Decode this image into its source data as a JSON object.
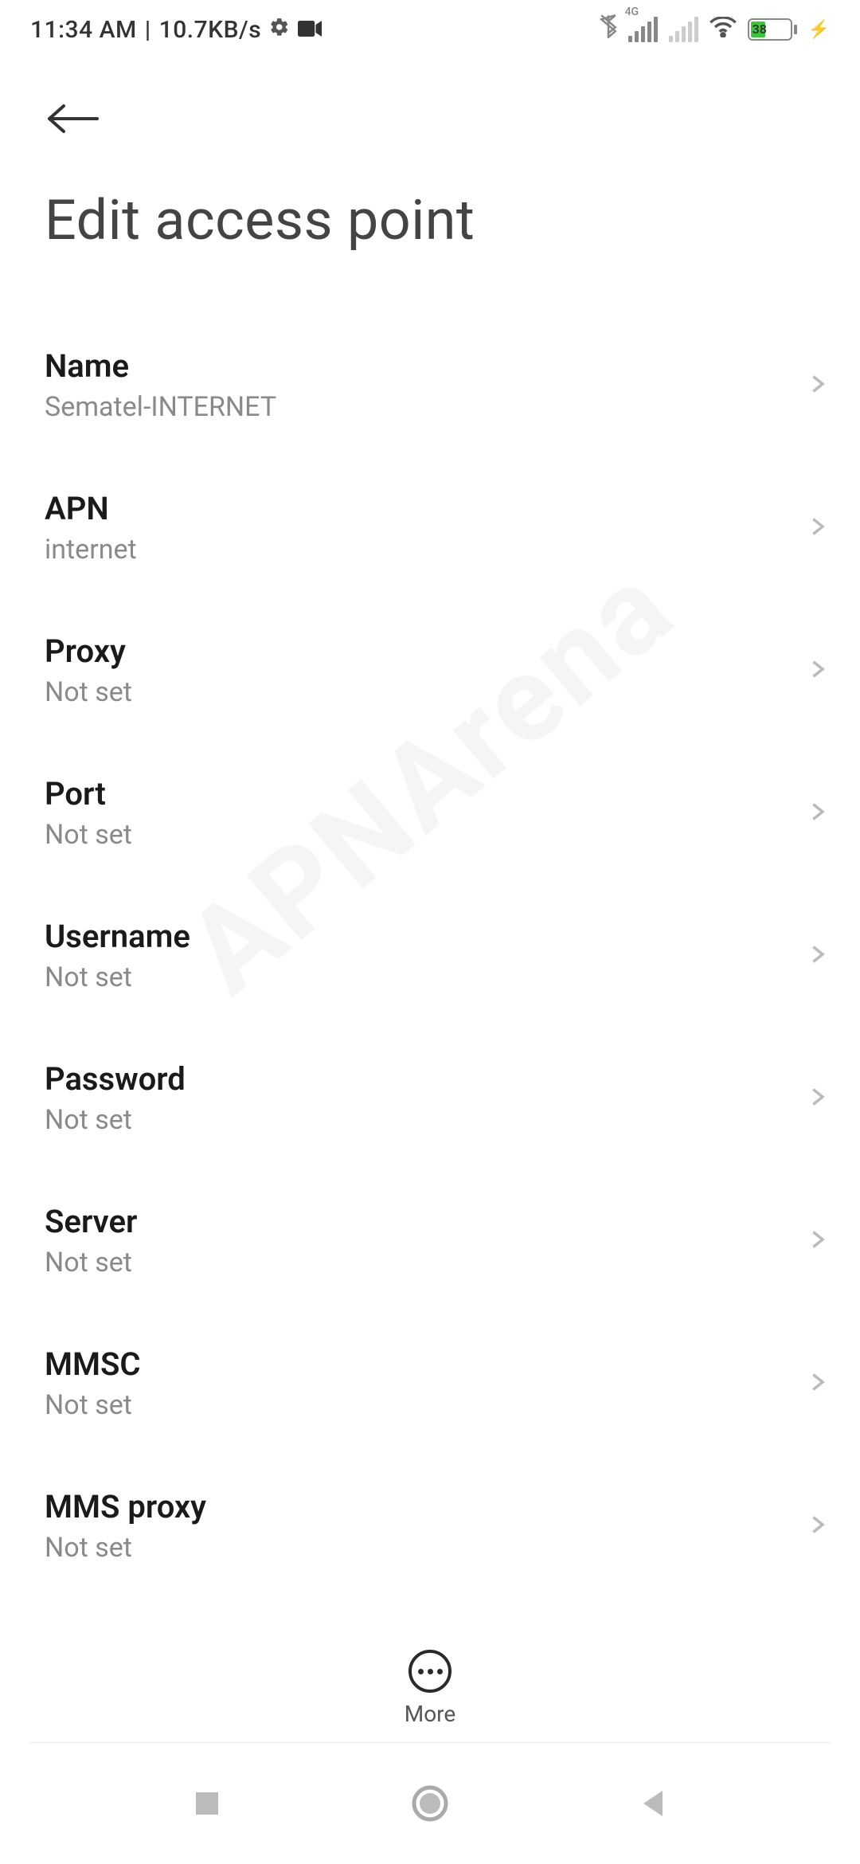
{
  "status_bar": {
    "time": "11:34 AM",
    "speed": "10.7KB/s",
    "network_type": "4G",
    "battery_percent": "38"
  },
  "header": {
    "title": "Edit access point"
  },
  "settings": [
    {
      "label": "Name",
      "value": "Sematel-INTERNET"
    },
    {
      "label": "APN",
      "value": "internet"
    },
    {
      "label": "Proxy",
      "value": "Not set"
    },
    {
      "label": "Port",
      "value": "Not set"
    },
    {
      "label": "Username",
      "value": "Not set"
    },
    {
      "label": "Password",
      "value": "Not set"
    },
    {
      "label": "Server",
      "value": "Not set"
    },
    {
      "label": "MMSC",
      "value": "Not set"
    },
    {
      "label": "MMS proxy",
      "value": "Not set"
    }
  ],
  "bottom": {
    "more_label": "More"
  },
  "watermark": "APNArena"
}
